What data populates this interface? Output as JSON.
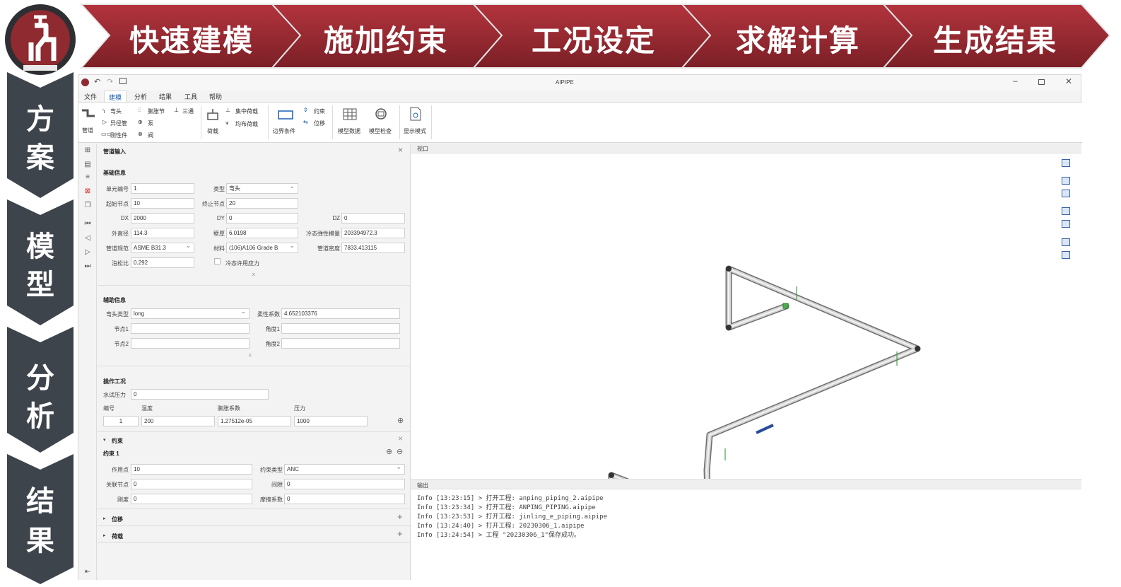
{
  "colors": {
    "banner_red": "#9e2b33",
    "banner_dark": "#6e1d22",
    "vstep_grey": "#3e444b",
    "logo_red": "#8e2a30"
  },
  "steps": [
    "快速建模",
    "施加约束",
    "工况设定",
    "求解计算",
    "生成结果"
  ],
  "vsteps": [
    {
      "line1": "方",
      "line2": "案"
    },
    {
      "line1": "模",
      "line2": "型"
    },
    {
      "line1": "分",
      "line2": "析"
    },
    {
      "line1": "结",
      "line2": "果"
    }
  ],
  "app": {
    "title": "AIPIPE",
    "menu": [
      "文件",
      "建模",
      "分析",
      "结果",
      "工具",
      "帮助"
    ],
    "ribbon": {
      "pipe": "管道",
      "elbow": "弯头",
      "reducer": "异径管",
      "rigid": "刚性件",
      "expansion": "膨胀节",
      "pump": "泵",
      "tee": "三通",
      "valve": "阀",
      "load": "荷载",
      "concentrated_load": "集中荷载",
      "distributed_load": "均布荷载",
      "boundary": "边界条件",
      "restraint": "约束",
      "displacement": "位移",
      "model_data": "模型数据",
      "model_check": "模型检查",
      "display_mode": "显示模式"
    },
    "panel": {
      "title": "管道输入",
      "basic": "基础信息",
      "element_no_label": "单元编号",
      "element_no": "1",
      "type_label": "类型",
      "type": "弯头",
      "start_node_label": "起始节点",
      "start_node": "10",
      "end_node_label": "终止节点",
      "end_node": "20",
      "dx_label": "DX",
      "dx": "2000",
      "dy_label": "DY",
      "dy": "0",
      "dz_label": "DZ",
      "dz": "0",
      "od_label": "外直径",
      "od": "114.3",
      "wall_label": "壁厚",
      "wall": "6.0198",
      "cold_e_label": "冷态弹性模量",
      "cold_e": "203394972.3",
      "code_label": "管道规范",
      "code": "ASME B31.3",
      "material_label": "材料",
      "material": "(106)A106 Grade B",
      "density_label": "管道密度",
      "density": "7833.413115",
      "poisson_label": "泊松比",
      "poisson": "0.292",
      "cold_allow_label": "冷态许用应力",
      "aux": "辅助信息",
      "bend_type_label": "弯头类型",
      "bend_type": "long",
      "flex_label": "柔性系数",
      "flex": "4.652103376",
      "node1_label": "节点1",
      "angle1_label": "角度1",
      "node2_label": "节点2",
      "angle2_label": "角度2",
      "op": "操作工况",
      "hydro_label": "水试压力",
      "hydro": "0",
      "col_no": "编号",
      "col_temp": "温度",
      "col_exp": "膨胀系数",
      "col_press": "压力",
      "row_no": "1",
      "row_temp": "200",
      "row_exp": "1.27512e-05",
      "row_press": "1000",
      "restraint": "约束",
      "restraint1": "约束 1",
      "act_label": "作用点",
      "act": "10",
      "rtype_label": "约束类型",
      "rtype": "ANC",
      "link_label": "关联节点",
      "link": "0",
      "gap_label": "间隙",
      "gap": "0",
      "stiff_label": "刚度",
      "stiff": "0",
      "fric_label": "摩擦系数",
      "fric": "0",
      "disp": "位移",
      "loads": "荷载"
    },
    "viewport_title": "视口",
    "output_title": "输出",
    "log": [
      "Info [13:23:15] > 打开工程: anping_piping_2.aipipe",
      "Info [13:23:34] > 打开工程: ANPING_PIPING.aipipe",
      "Info [13:23:53] > 打开工程: jinling_e_piping.aipipe",
      "Info [13:24:40] > 打开工程: 20230306_1.aipipe",
      "Info [13:24:54] > 工程 \"20230306_1\"保存成功。"
    ]
  }
}
